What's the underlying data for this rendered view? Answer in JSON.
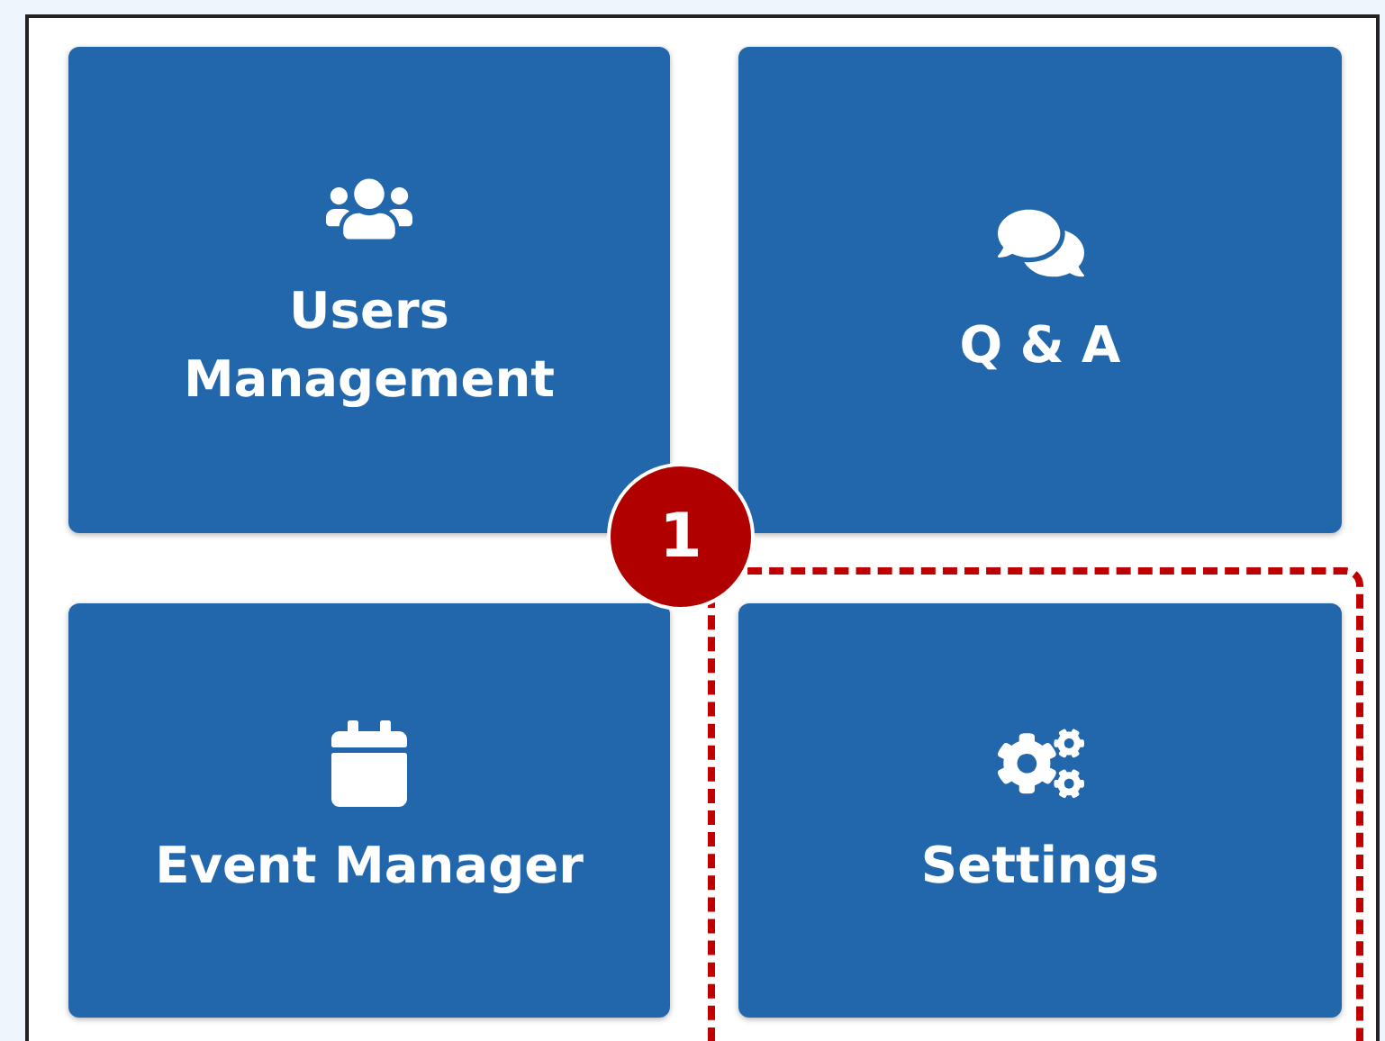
{
  "tiles": [
    {
      "label": "Users\nManagement",
      "kind": "users",
      "highlighted": false
    },
    {
      "label": "Q & A",
      "kind": "chat",
      "highlighted": false
    },
    {
      "label": "Event Manager",
      "kind": "events",
      "highlighted": false
    },
    {
      "label": "Settings",
      "kind": "settings",
      "highlighted": true
    }
  ],
  "callout": {
    "number": "1"
  }
}
